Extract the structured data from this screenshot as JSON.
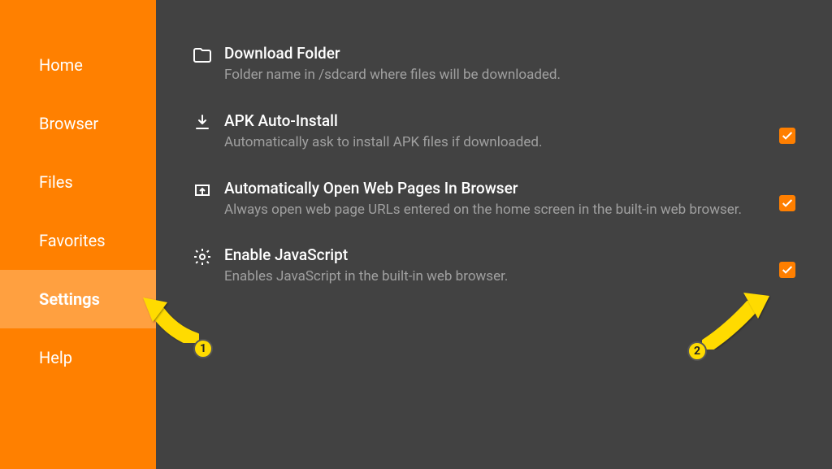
{
  "sidebar": {
    "items": [
      {
        "label": "Home"
      },
      {
        "label": "Browser"
      },
      {
        "label": "Files"
      },
      {
        "label": "Favorites"
      },
      {
        "label": "Settings"
      },
      {
        "label": "Help"
      }
    ],
    "active_index": 4
  },
  "settings": [
    {
      "key": "download-folder",
      "icon": "folder-icon",
      "title": "Download Folder",
      "desc": "Folder name in /sdcard where files will be downloaded.",
      "has_checkbox": false
    },
    {
      "key": "apk-auto-install",
      "icon": "download-icon",
      "title": "APK Auto-Install",
      "desc": "Automatically ask to install APK files if downloaded.",
      "has_checkbox": true,
      "checked": true
    },
    {
      "key": "auto-open-browser",
      "icon": "open-in-browser-icon",
      "title": "Automatically Open Web Pages In Browser",
      "desc": "Always open web page URLs entered on the home screen in the built-in web browser.",
      "has_checkbox": true,
      "checked": true
    },
    {
      "key": "enable-javascript",
      "icon": "gear-icon",
      "title": "Enable JavaScript",
      "desc": "Enables JavaScript in the built-in web browser.",
      "has_checkbox": true,
      "checked": true
    }
  ],
  "annotations": {
    "badge1": "1",
    "badge2": "2"
  },
  "colors": {
    "accent": "#ff8000",
    "bg": "#424242",
    "arrow": "#ffdb00"
  }
}
